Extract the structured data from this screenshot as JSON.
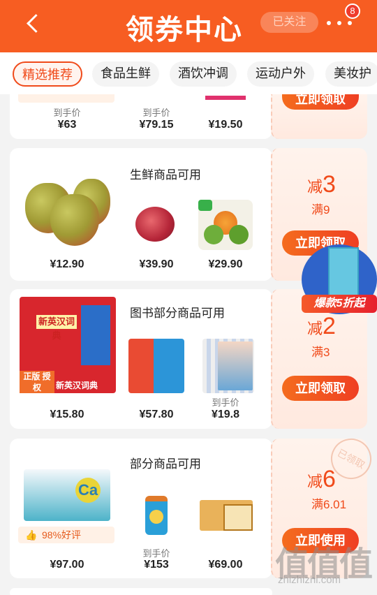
{
  "header": {
    "title": "领券中心",
    "follow_label": "已关注",
    "badge_count": "8"
  },
  "tabs": [
    {
      "label": "精选推荐",
      "active": true
    },
    {
      "label": "食品生鲜"
    },
    {
      "label": "酒饮冲调"
    },
    {
      "label": "运动户外"
    },
    {
      "label": "美妆护"
    }
  ],
  "card0": {
    "prices": [
      {
        "sub": "到手价",
        "price": "¥63"
      },
      {
        "sub": "到手价",
        "price": "¥79.15"
      },
      {
        "sub": "",
        "price": "¥19.50"
      }
    ],
    "button": "立即领取"
  },
  "card1": {
    "title": "生鲜商品可用",
    "prices": [
      "¥12.90",
      "¥39.90",
      "¥29.90"
    ],
    "reduce": "3",
    "reduce_prefix": "减",
    "cond": "满9",
    "button": "立即领取"
  },
  "card2": {
    "title": "图书部分商品可用",
    "prices": [
      "¥15.80",
      "¥57.80",
      "¥19.8"
    ],
    "sub3": "到手价",
    "reduce": "2",
    "reduce_prefix": "减",
    "cond": "满3",
    "button": "立即领取",
    "dict_yellow": "新英汉词典",
    "dict_tag": "正版 授权",
    "dict_bottom": "新英汉词典"
  },
  "card3": {
    "title": "部分商品可用",
    "goodrate": "98%好评",
    "prices": [
      "¥97.00",
      "¥153",
      "¥69.00"
    ],
    "sub2": "到手价",
    "reduce": "6",
    "reduce_prefix": "减",
    "cond": "满6.01",
    "button": "立即使用",
    "stamp": "已领取",
    "ca_label": "Ca"
  },
  "float_ad": {
    "label": "爆款5折起"
  },
  "watermark": {
    "big": "值值值",
    "small": "zhizhizhi.com"
  },
  "colors": {
    "brand": "#f75d22",
    "accent": "#f04a1a"
  }
}
